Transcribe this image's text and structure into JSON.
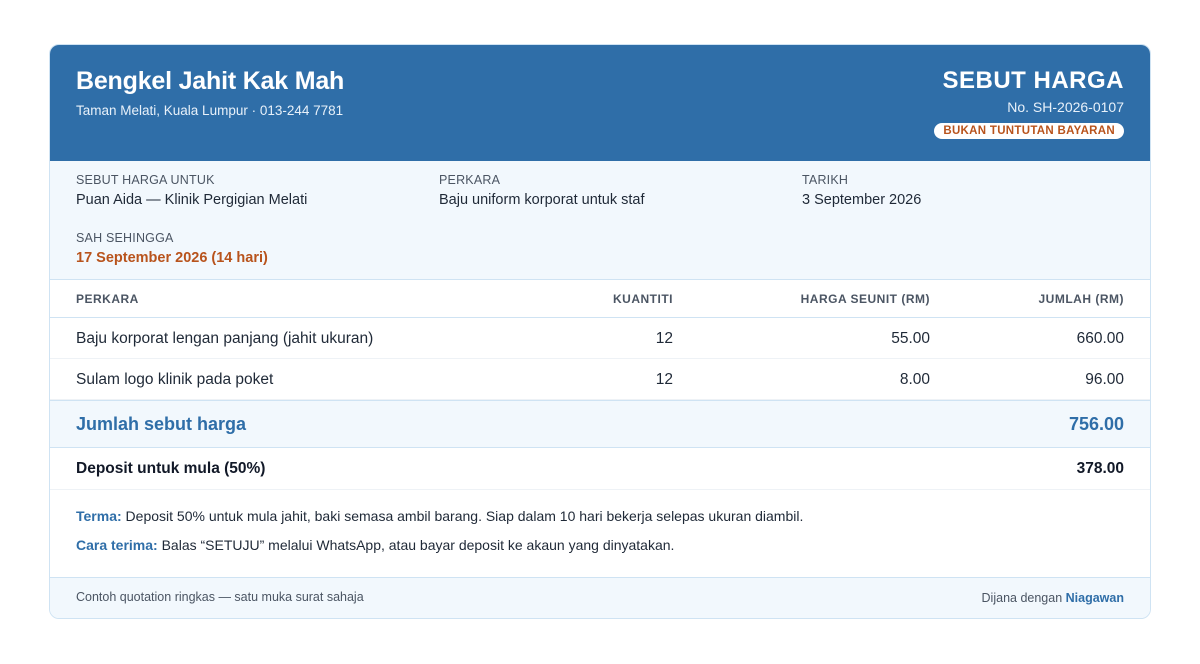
{
  "business": {
    "name": "Bengkel Jahit Kak Mah",
    "contact": "Taman Melati, Kuala Lumpur · 013-244 7781"
  },
  "document": {
    "title": "SEBUT HARGA",
    "number": "No. SH-2026-0107",
    "badge": "BUKAN TUNTUTAN BAYARAN"
  },
  "meta": {
    "to_label": "SEBUT HARGA UNTUK",
    "to_value": "Puan Aida — Klinik Pergigian Melati",
    "subject_label": "PERKARA",
    "subject_value": "Baju uniform korporat untuk staf",
    "date_label": "TARIKH",
    "date_value": "3 September 2026",
    "valid_label": "SAH SEHINGGA",
    "valid_value": "17 September 2026 (14 hari)"
  },
  "table": {
    "headers": [
      "PERKARA",
      "KUANTITI",
      "HARGA SEUNIT (RM)",
      "JUMLAH (RM)"
    ],
    "rows": [
      [
        "Baju korporat lengan panjang (jahit ukuran)",
        "12",
        "55.00",
        "660.00"
      ],
      [
        "Sulam logo klinik pada poket",
        "12",
        "8.00",
        "96.00"
      ]
    ]
  },
  "totals": {
    "total_label": "Jumlah sebut harga",
    "total_value": "756.00",
    "deposit_label": "Deposit untuk mula (50%)",
    "deposit_value": "378.00"
  },
  "notes": {
    "terms_key": "Terma:",
    "terms_text": "Deposit 50% untuk mula jahit, baki semasa ambil barang. Siap dalam 10 hari bekerja selepas ukuran diambil.",
    "accept_key": "Cara terima:",
    "accept_text": "Balas “SETUJU” melalui WhatsApp, atau bayar deposit ke akaun yang dinyatakan."
  },
  "footer": {
    "left": "Contoh quotation ringkas — satu muka surat sahaja",
    "right_prefix": "Dijana dengan",
    "brand": "Niagawan"
  },
  "colors": {
    "primary": "#2f6ea8",
    "accent": "#b8531c",
    "panel": "#f2f8fd",
    "border": "#cfe3f3"
  }
}
